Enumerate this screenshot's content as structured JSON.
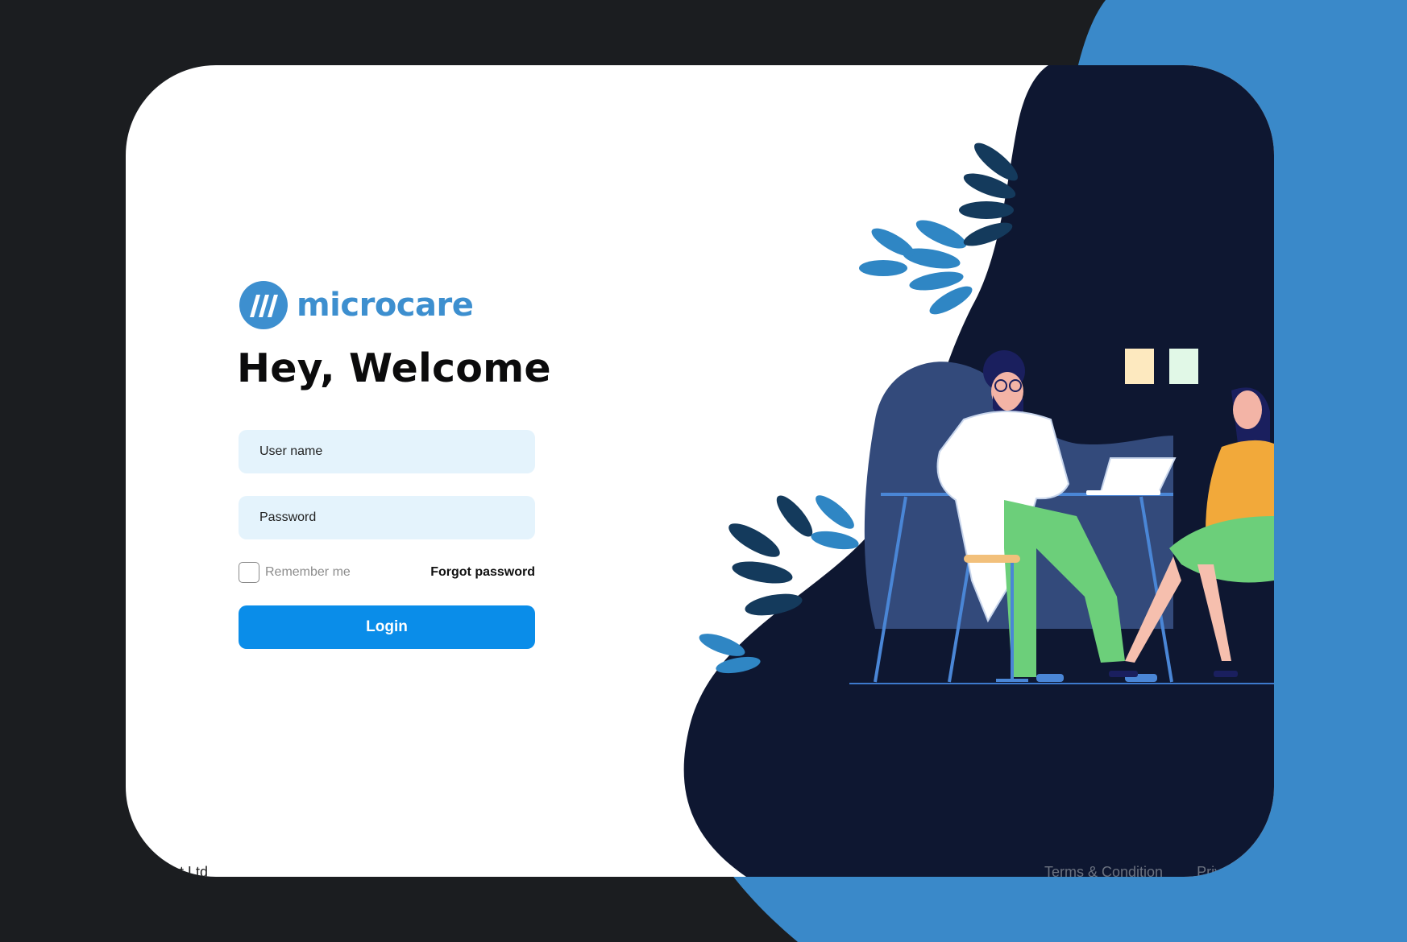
{
  "brand": {
    "name": "microcare",
    "color": "#3d8fcf"
  },
  "login": {
    "title": "Hey, Welcome",
    "username_placeholder": "User name",
    "password_placeholder": "Password",
    "remember_label": "Remember me",
    "remember_checked": false,
    "forgot_label": "Forgot password",
    "button_label": "Login",
    "button_color": "#0a8de9",
    "field_color": "#e4f3fc"
  },
  "footer": {
    "company": "Pvt Ltd",
    "terms": "Terms & Condition",
    "privacy": "Priv"
  },
  "illustration": {
    "background_color": "#0e1731",
    "accent_color": "#3a89c9",
    "icons": [
      "doctor-illustration",
      "patient-illustration",
      "laptop-icon",
      "plant-leaves-icon",
      "sticky-note-icon"
    ]
  }
}
